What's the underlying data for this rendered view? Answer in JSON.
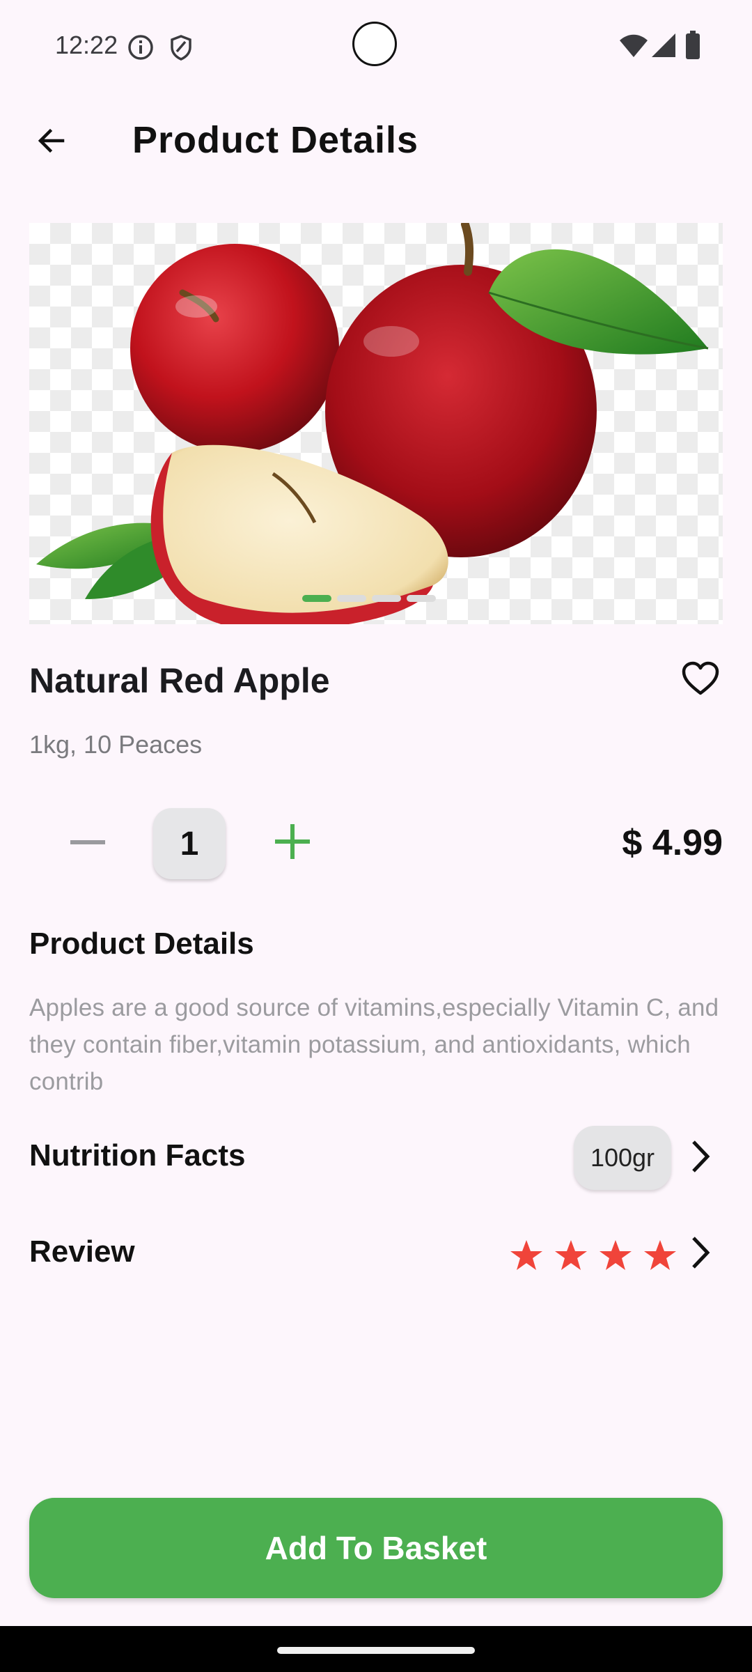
{
  "status_bar": {
    "time": "12:22",
    "icons": [
      "info-icon",
      "shield-icon",
      "wifi-icon",
      "signal-icon",
      "battery-icon"
    ]
  },
  "app_bar": {
    "back_icon": "arrow-left-icon",
    "title": "Product Details"
  },
  "product": {
    "name": "Natural Red Apple",
    "subtitle": "1kg, 10 Peaces",
    "image_subject": "red apples with slice and leaves",
    "carousel_pages": 4,
    "carousel_active_index": 0,
    "favorite_icon": "heart-outline-icon",
    "quantity": "1",
    "price": "$ 4.99"
  },
  "details": {
    "title": "Product Details",
    "text": "Apples are a good source of vitamins,especially Vitamin C, and they contain fiber,vitamin potassium, and antioxidants, which contrib"
  },
  "nutrition": {
    "title": "Nutrition Facts",
    "badge": "100gr"
  },
  "review": {
    "title": "Review",
    "rating": 4,
    "star_color": "#f0443a"
  },
  "cta": {
    "label": "Add To Basket"
  },
  "colors": {
    "accent": "#4caf50",
    "background": "#fdf6fc",
    "star": "#f0443a"
  }
}
